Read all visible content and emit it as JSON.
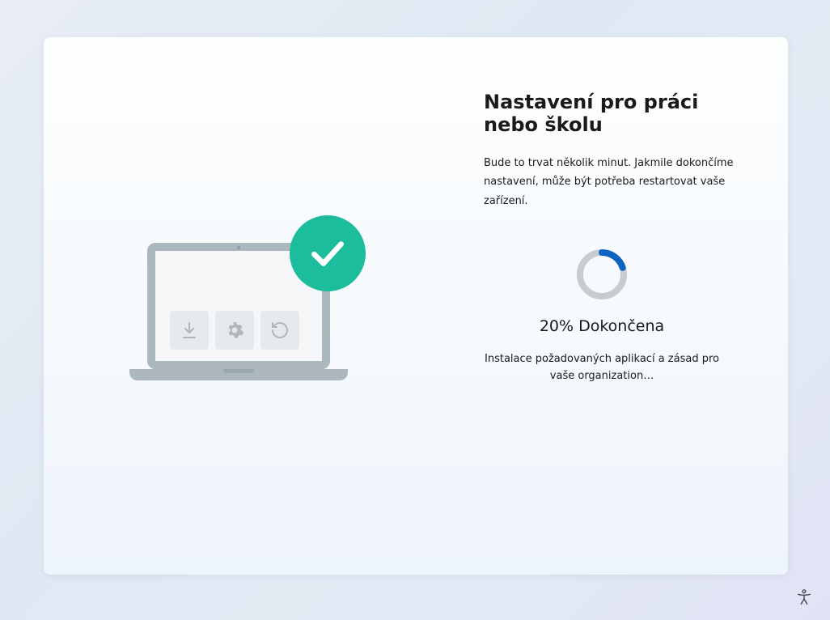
{
  "header": {
    "title": "Nastavení pro práci nebo školu",
    "subtitle": "Bude to trvat několik minut. Jakmile dokončíme nastavení, může být potřeba restartovat vaše zařízení."
  },
  "progress": {
    "percent_value": 20,
    "percent_label": "20%",
    "done_label": "Dokončena",
    "status": "Instalace požadovaných aplikací a zásad pro vaše organization…"
  },
  "colors": {
    "accent_blue": "#0a66c2",
    "ring_track": "#c7ccd1",
    "badge_green": "#1cbd9c"
  },
  "illustration_tiles": {
    "download": "download-icon",
    "settings": "gear-icon",
    "refresh": "refresh-icon"
  },
  "accessibility_button": "Accessibility"
}
